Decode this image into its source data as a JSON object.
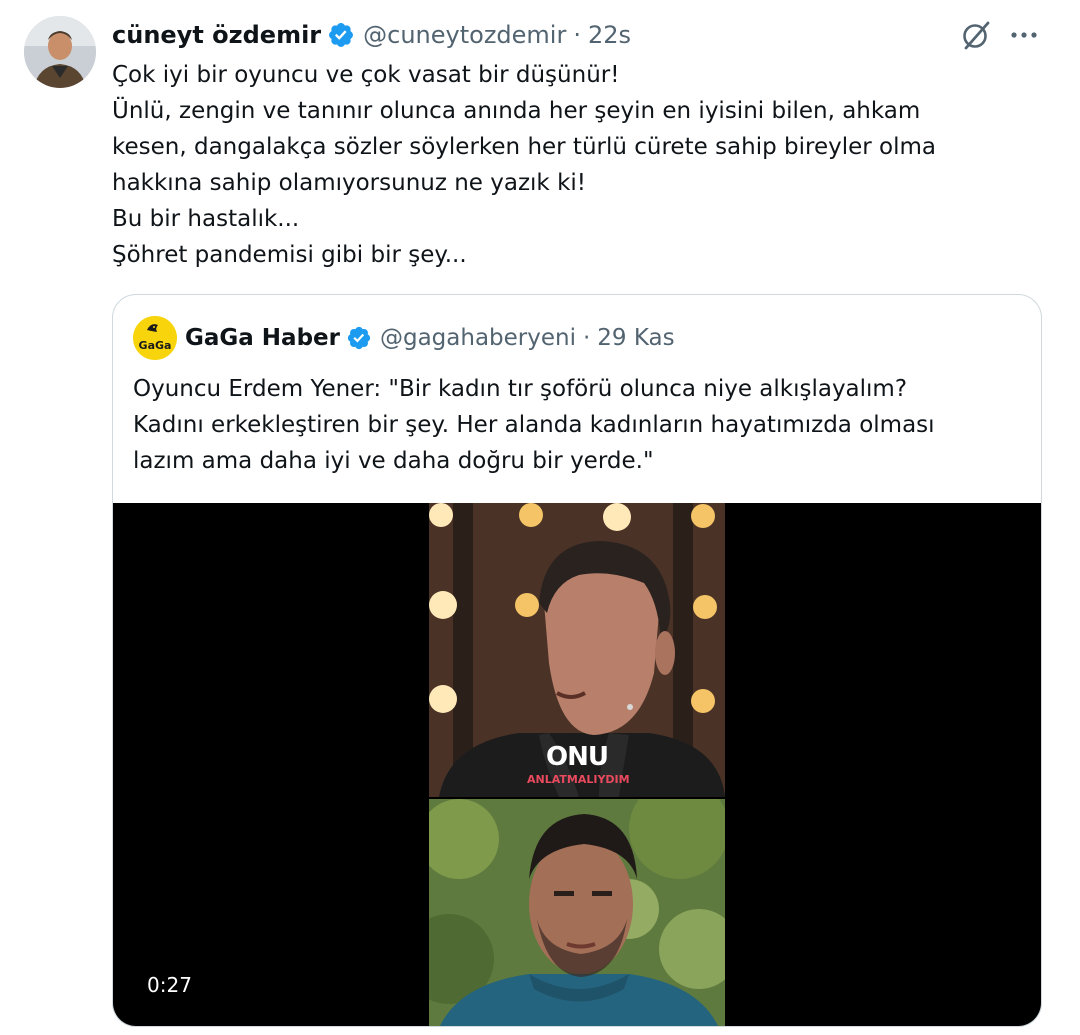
{
  "tweet": {
    "author": {
      "display_name": "cüneyt özdemir",
      "handle": "@cuneytozdemir",
      "verified": true,
      "verified_icon": "verified-badge-icon"
    },
    "separator": "·",
    "timestamp": "22s",
    "actions": {
      "grok_icon": "grok-icon",
      "more_icon": "more-options-icon"
    },
    "text_lines": [
      "Çok iyi bir oyuncu ve çok vasat bir düşünür!",
      "Ünlü, zengin ve tanınır olunca anında her şeyin en iyisini bilen, ahkam",
      "kesen, dangalakça sözler söylerken her türlü cürete sahip bireyler olma",
      "hakkına sahip olamıyorsunuz ne yazık ki!",
      "Bu bir hastalık...",
      "Şöhret pandemisi gibi bir şey..."
    ]
  },
  "quote": {
    "author": {
      "display_name": "GaGa Haber",
      "handle": "@gagahaberyeni",
      "verified": true,
      "avatar_label": "GaGa"
    },
    "separator": "·",
    "timestamp": "29 Kas",
    "text_lines": [
      "Oyuncu Erdem Yener: \"Bir kadın tır şoförü olunca niye alkışlayalım?",
      "Kadını erkekleştiren bir şey. Her alanda kadınların hayatımızda olması",
      "lazım ama daha iyi ve daha doğru bir yerde.\""
    ],
    "media": {
      "type": "video",
      "duration": "0:27",
      "caption_big": "ONU",
      "caption_small": "ANLATMALIYDIM"
    }
  },
  "colors": {
    "text_primary": "#0f1419",
    "text_secondary": "#536471",
    "verified_blue": "#1d9bf0",
    "border": "#cfd9de",
    "gaga_yellow": "#f7d40b"
  }
}
